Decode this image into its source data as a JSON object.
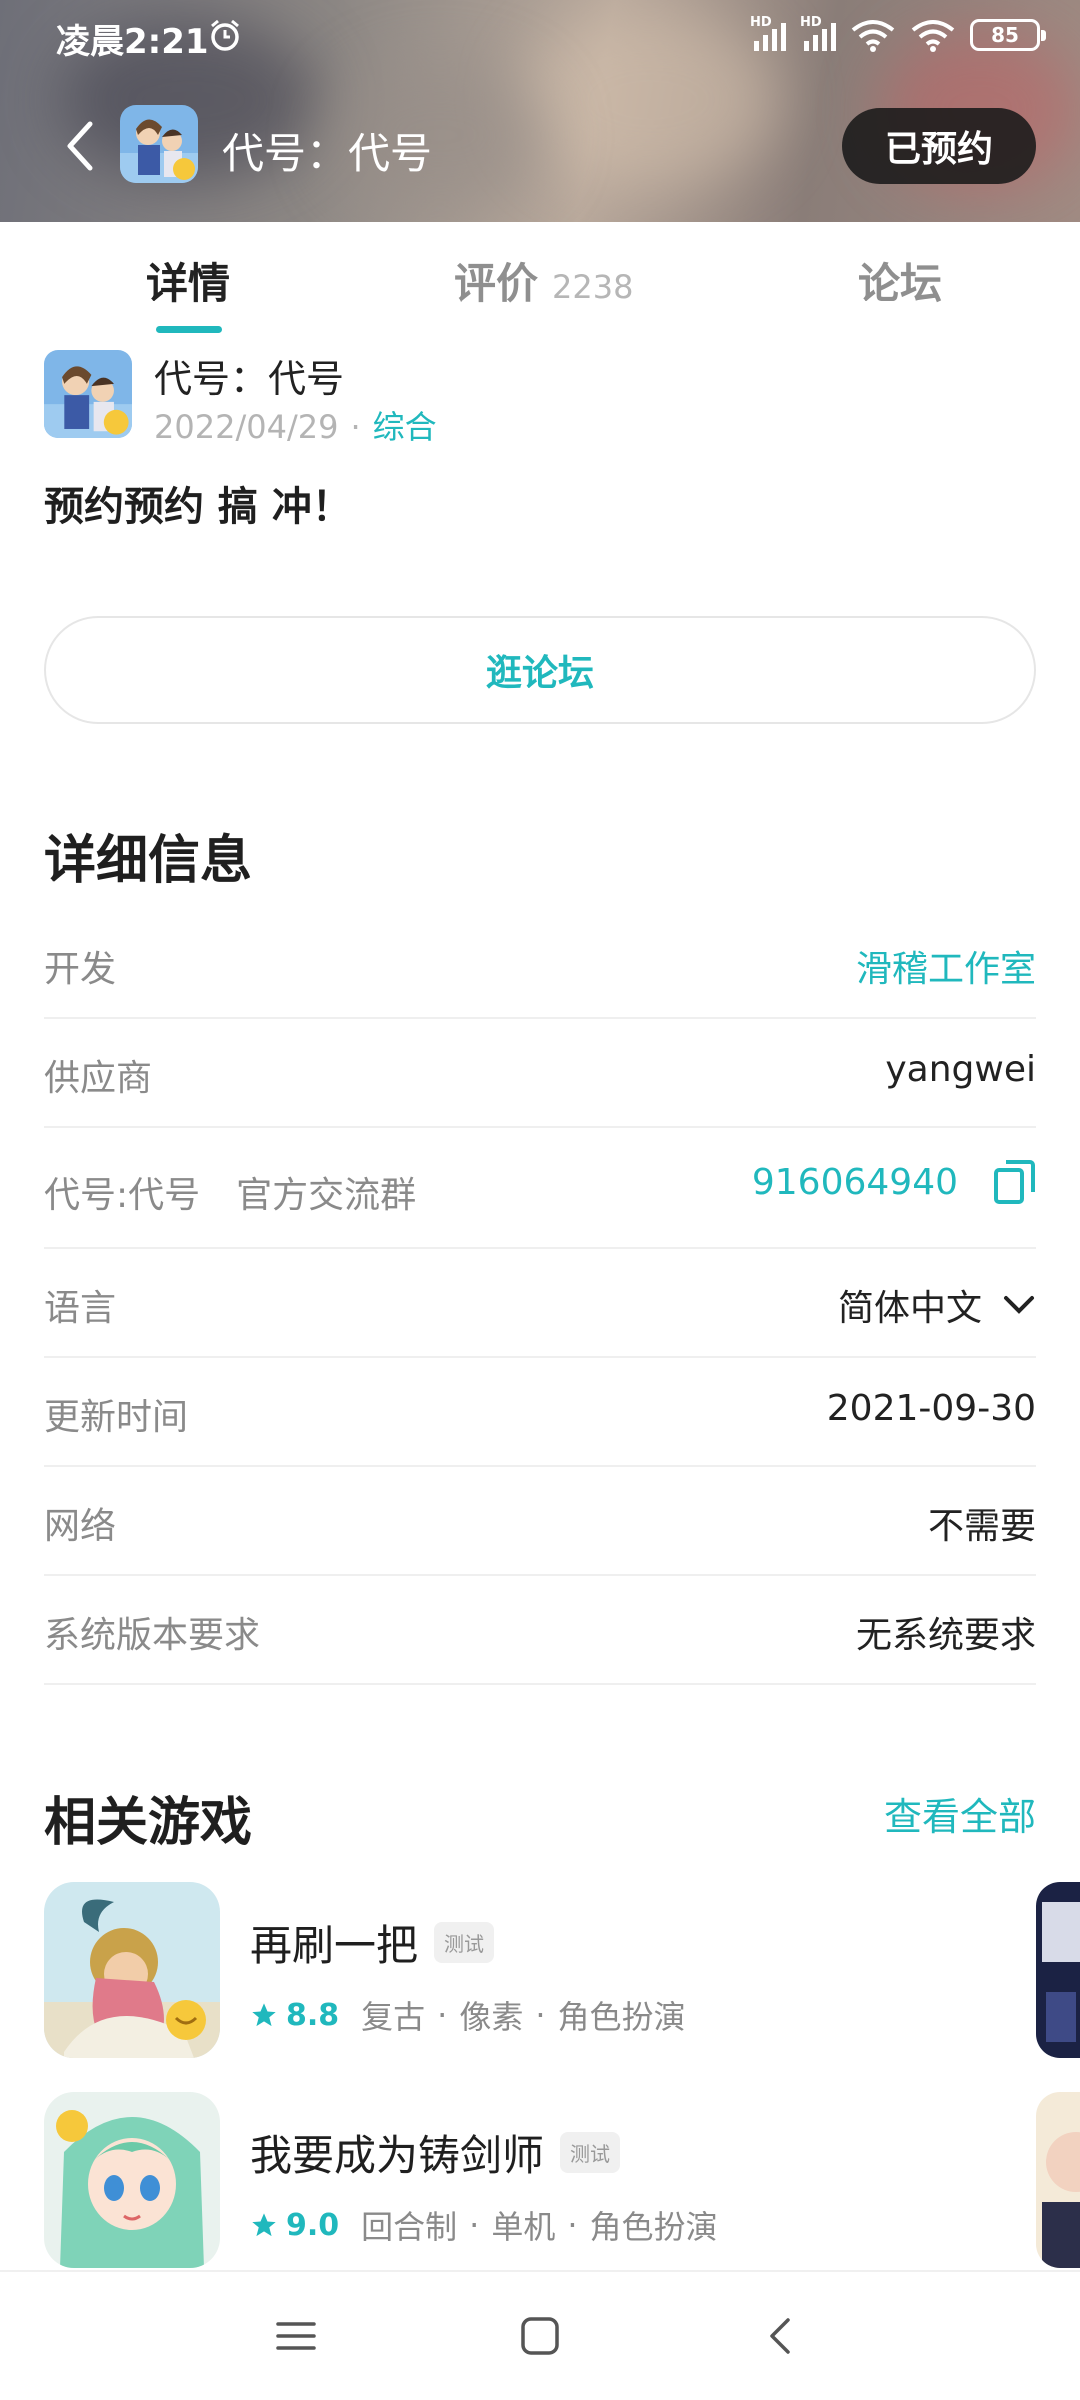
{
  "status_bar": {
    "time": "凌晨2:21",
    "battery": "85",
    "signal_1_label": "HD",
    "signal_2_label": "HD"
  },
  "header": {
    "title": "代号：代号",
    "reserved_label": "已预约"
  },
  "tabs": [
    {
      "label": "详情",
      "active": true
    },
    {
      "label": "评价",
      "count": "2238",
      "active": false
    },
    {
      "label": "论坛",
      "active": false
    }
  ],
  "post": {
    "author": "代号：代号",
    "date": "2022/04/29",
    "separator": "·",
    "category": "综合",
    "content": "预约预约 搞 冲！"
  },
  "forum_button_label": "逛论坛",
  "details": {
    "title": "详细信息",
    "rows": [
      {
        "label": "开发",
        "value": "滑稽工作室",
        "link": true
      },
      {
        "label": "供应商",
        "value": "yangwei"
      },
      {
        "label": "代号:代号　官方交流群",
        "value": "916064940",
        "link": true,
        "icon": "copy-icon"
      },
      {
        "label": "语言",
        "value": "简体中文",
        "icon": "chevron-down-icon"
      },
      {
        "label": "更新时间",
        "value": "2021-09-30"
      },
      {
        "label": "网络",
        "value": "不需要"
      },
      {
        "label": "系统版本要求",
        "value": "无系统要求"
      }
    ]
  },
  "related": {
    "title": "相关游戏",
    "view_all": "查看全部",
    "games": [
      {
        "name": "再刷一把",
        "tag": "测试",
        "score": "8.8",
        "genres": [
          "复古",
          "像素",
          "角色扮演"
        ]
      },
      {
        "name": "我要成为铸剑师",
        "tag": "测试",
        "score": "9.0",
        "genres": [
          "回合制",
          "单机",
          "角色扮演"
        ]
      }
    ]
  },
  "colors": {
    "accent": "#20b8bd",
    "text": "#1f1f1f",
    "muted": "#8a8a8a"
  },
  "bottom_nav": [
    "menu-icon",
    "home-icon",
    "back-icon"
  ]
}
